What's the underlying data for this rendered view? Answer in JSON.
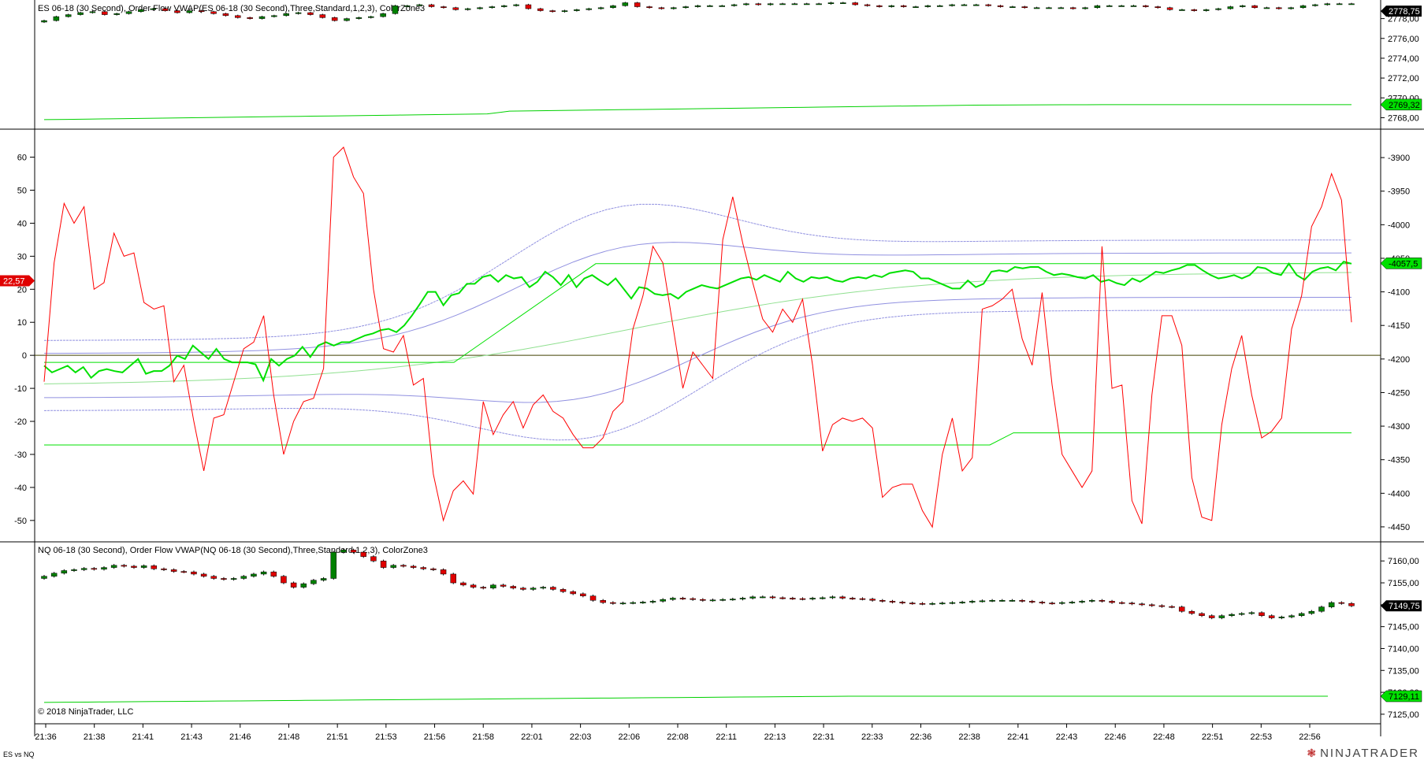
{
  "window": {
    "tab_label": "ES vs NQ",
    "brand": "NINJATRADER",
    "brand_icon": "ninja-logo-icon"
  },
  "colors": {
    "up": "#008000",
    "down": "#e00000",
    "vwap": "#00d000",
    "band": "#9090e0",
    "spread": "#ff0000",
    "diff": "#00e000",
    "zero": "#404000"
  },
  "chart_data": [
    {
      "type": "candlestick",
      "title": "ES 06-18 (30 Second), Order Flow VWAP(ES 06-18 (30 Second),Three,Standard,1,2,3), ColorZone3",
      "ylim": [
        2767,
        2779.4
      ],
      "y_ticks": [
        "2778,00",
        "2776,00",
        "2774,00",
        "2772,00",
        "2770,00",
        "2768,00"
      ],
      "y_tick_values": [
        2778,
        2776,
        2774,
        2772,
        2770,
        2768
      ],
      "last_price_label": "2778,75",
      "last_price": 2778.75,
      "vwap_label": "2769,32",
      "vwap_value": 2769.32,
      "closes": [
        2777.8,
        2778.2,
        2778.4,
        2778.6,
        2778.7,
        2778.4,
        2778.5,
        2778.7,
        2778.9,
        2779.0,
        2778.8,
        2778.6,
        2778.8,
        2778.7,
        2778.5,
        2778.3,
        2778.1,
        2778.0,
        2778.2,
        2778.3,
        2778.5,
        2778.6,
        2778.4,
        2778.1,
        2777.8,
        2778.0,
        2778.1,
        2778.2,
        2778.5,
        2779.3,
        2779.3,
        2779.4,
        2779.2,
        2779.1,
        2778.9,
        2779.0,
        2779.1,
        2779.2,
        2779.3,
        2779.4,
        2779.0,
        2778.8,
        2778.7,
        2778.8,
        2778.9,
        2779.0,
        2779.1,
        2779.3,
        2779.6,
        2779.2,
        2779.1,
        2779.0,
        2779.1,
        2779.2,
        2779.3,
        2779.3,
        2779.3,
        2779.4,
        2779.5,
        2779.4,
        2779.5,
        2779.5,
        2779.5,
        2779.5,
        2779.5,
        2779.6,
        2779.6,
        2779.4,
        2779.3,
        2779.2,
        2779.3,
        2779.2,
        2779.2,
        2779.3,
        2779.3,
        2779.4,
        2779.4,
        2779.4,
        2779.3,
        2779.2,
        2779.2,
        2779.1,
        2779.1,
        2779.1,
        2779.1,
        2779.0,
        2779.1,
        2779.3,
        2779.3,
        2779.3,
        2779.3,
        2779.2,
        2779.1,
        2778.9,
        2778.9,
        2778.8,
        2778.9,
        2779.0,
        2779.2,
        2779.3,
        2779.1,
        2779.1,
        2779.0,
        2779.1,
        2779.3,
        2779.4,
        2779.5,
        2779.5,
        2779.5
      ]
    },
    {
      "type": "line",
      "title": "",
      "left_ylim": [
        -56,
        68
      ],
      "left_ticks": [
        "60",
        "50",
        "40",
        "30",
        "20",
        "10",
        "0",
        "-10",
        "-20",
        "-30",
        "-40",
        "-50"
      ],
      "left_tick_values": [
        60,
        50,
        40,
        30,
        20,
        10,
        0,
        -10,
        -20,
        -30,
        -40,
        -50
      ],
      "right_ylim": [
        -4470,
        -3860
      ],
      "right_ticks": [
        "-3900",
        "-3950",
        "-4000",
        "-4050",
        "-4100",
        "-4150",
        "-4200",
        "-4250",
        "-4300",
        "-4350",
        "-4400",
        "-4450"
      ],
      "right_tick_values": [
        -3900,
        -3950,
        -4000,
        -4050,
        -4100,
        -4150,
        -4200,
        -4250,
        -4300,
        -4350,
        -4400,
        -4450
      ],
      "left_last_label": "22,57",
      "left_last_value": 22.57,
      "right_last_label": "-4057,5",
      "right_last_value": -4057.5,
      "series": [
        {
          "values": [
            -8,
            28,
            46,
            40,
            45,
            20,
            22,
            37,
            30,
            31,
            16,
            14,
            15,
            -8,
            -3,
            -20,
            -35,
            -19,
            -18,
            -8,
            2,
            4,
            12,
            -12,
            -30,
            -20,
            -14,
            -13,
            -4,
            60,
            63,
            54,
            49,
            20,
            2,
            1,
            6,
            -9,
            -7,
            -36,
            -50,
            -41,
            -38,
            -42,
            -14,
            -24,
            -18,
            -14,
            -22,
            -15,
            -12,
            -17,
            -19,
            -24,
            -28,
            -28,
            -25,
            -17,
            -14,
            8,
            18,
            33,
            28,
            9,
            -10,
            1,
            -3,
            -7,
            35,
            48,
            34,
            22,
            11,
            7,
            14,
            10,
            17,
            -3,
            -29,
            -21,
            -19,
            -20,
            -19,
            -22,
            -43,
            -40,
            -39,
            -39,
            -47,
            -52,
            -30,
            -19,
            -35,
            -31,
            14,
            15,
            17,
            20,
            5,
            -3,
            19,
            -9,
            -30,
            -35,
            -40,
            -35,
            33,
            -10,
            -9,
            -44,
            -51,
            -12,
            12,
            12,
            3,
            -37,
            -49,
            -50,
            -21,
            -4,
            6,
            -12,
            -25,
            -23,
            -19,
            8,
            18,
            39,
            45,
            55,
            47,
            10
          ],
          "color": "#ff0000"
        },
        {
          "values": [
            -4210,
            -4220,
            -4215,
            -4210,
            -4220,
            -4212,
            -4228,
            -4218,
            -4215,
            -4218,
            -4220,
            -4210,
            -4200,
            -4222,
            -4218,
            -4218,
            -4210,
            -4195,
            -4200,
            -4180,
            -4190,
            -4200,
            -4185,
            -4200,
            -4205,
            -4205,
            -4205,
            -4208,
            -4232,
            -4200,
            -4210,
            -4200,
            -4195,
            -4182,
            -4197,
            -4180,
            -4175,
            -4180,
            -4175,
            -4175,
            -4170,
            -4165,
            -4162,
            -4157,
            -4155,
            -4160,
            -4150,
            -4135,
            -4118,
            -4100,
            -4100,
            -4120,
            -4105,
            -4102,
            -4088,
            -4088,
            -4078,
            -4075,
            -4085,
            -4075,
            -4080,
            -4078,
            -4093,
            -4085,
            -4070,
            -4078,
            -4090,
            -4075,
            -4093,
            -4080,
            -4075,
            -4083,
            -4090,
            -4080,
            -4095,
            -4110,
            -4093,
            -4095,
            -4103,
            -4105,
            -4103,
            -4110,
            -4100,
            -4095,
            -4090,
            -4093,
            -4095,
            -4090,
            -4085,
            -4080,
            -4078,
            -4082,
            -4075,
            -4080,
            -4085,
            -4070,
            -4080,
            -4085,
            -4078,
            -4080,
            -4078,
            -4083,
            -4085,
            -4080,
            -4078,
            -4080,
            -4075,
            -4078,
            -4072,
            -4070,
            -4068,
            -4070,
            -4080,
            -4080,
            -4085,
            -4090,
            -4095,
            -4095,
            -4083,
            -4093,
            -4088,
            -4070,
            -4068,
            -4070,
            -4063,
            -4065,
            -4063,
            -4063,
            -4070,
            -4075,
            -4073,
            -4075,
            -4078,
            -4080,
            -4075,
            -4085,
            -4082,
            -4087,
            -4090,
            -4080,
            -4085,
            -4078,
            -4070,
            -4072,
            -4068,
            -4065,
            -4060,
            -4060,
            -4068,
            -4075,
            -4080,
            -4078,
            -4075,
            -4080,
            -4075,
            -4063,
            -4065,
            -4072,
            -4075,
            -4058,
            -4075,
            -4082,
            -4070,
            -4065,
            -4063,
            -4068,
            -4055,
            -4058
          ],
          "color": "#00e000"
        }
      ]
    },
    {
      "type": "candlestick",
      "title": "NQ 06-18 (30 Second), Order Flow VWAP(NQ 06-18 (30 Second),Three,Standard,1,2,3), ColorZone3",
      "ylim": [
        7123,
        7164
      ],
      "y_ticks": [
        "7160,00",
        "7155,00",
        "7150,00",
        "7145,00",
        "7140,00",
        "7135,00",
        "7130,00",
        "7125,00"
      ],
      "y_tick_values": [
        7160,
        7155,
        7150,
        7145,
        7140,
        7135,
        7130,
        7125
      ],
      "last_price_label": "7149,75",
      "last_price": 7149.75,
      "vwap_label": "7129,11",
      "vwap_value": 7129.11,
      "watermark": "© 2018 NinjaTrader, LLC",
      "closes": [
        7156.5,
        7157.2,
        7157.8,
        7158.0,
        7158.3,
        7158.1,
        7158.5,
        7159.0,
        7158.8,
        7158.5,
        7158.9,
        7158.2,
        7158.0,
        7157.6,
        7157.5,
        7157.0,
        7156.5,
        7156.0,
        7155.8,
        7156.0,
        7156.5,
        7157.0,
        7157.5,
        7156.5,
        7155.0,
        7154.0,
        7154.8,
        7155.6,
        7156.0,
        7162.0,
        7162.5,
        7162.0,
        7161.0,
        7160.0,
        7158.5,
        7159.0,
        7158.8,
        7158.5,
        7158.2,
        7158.0,
        7157.0,
        7155.0,
        7154.5,
        7154.0,
        7153.8,
        7154.5,
        7154.2,
        7153.8,
        7153.5,
        7153.8,
        7154.0,
        7153.5,
        7153.0,
        7152.5,
        7152.0,
        7151.0,
        7150.5,
        7150.3,
        7150.4,
        7150.5,
        7150.6,
        7150.8,
        7151.2,
        7151.5,
        7151.4,
        7151.2,
        7151.0,
        7151.1,
        7151.2,
        7151.3,
        7151.5,
        7151.8,
        7151.8,
        7151.6,
        7151.5,
        7151.4,
        7151.3,
        7151.5,
        7151.6,
        7151.8,
        7151.5,
        7151.4,
        7151.3,
        7151.0,
        7150.8,
        7150.6,
        7150.4,
        7150.3,
        7150.2,
        7150.3,
        7150.4,
        7150.5,
        7150.6,
        7150.8,
        7150.9,
        7151.0,
        7151.0,
        7151.0,
        7150.8,
        7150.6,
        7150.4,
        7150.3,
        7150.5,
        7150.6,
        7150.8,
        7151.0,
        7150.8,
        7150.5,
        7150.4,
        7150.2,
        7150.0,
        7149.8,
        7149.6,
        7149.5,
        7148.5,
        7148.0,
        7147.5,
        7147.0,
        7147.5,
        7147.8,
        7148.0,
        7148.2,
        7147.5,
        7147.0,
        7147.2,
        7147.5,
        7148.0,
        7148.5,
        7149.5,
        7150.5,
        7150.3,
        7149.75
      ]
    }
  ],
  "x_axis": {
    "labels": [
      "21:36",
      "21:38",
      "21:41",
      "21:43",
      "21:46",
      "21:48",
      "21:51",
      "21:53",
      "21:56",
      "21:58",
      "22:01",
      "22:03",
      "22:06",
      "22:08",
      "22:11",
      "22:13",
      "22:31",
      "22:33",
      "22:36",
      "22:38",
      "22:41",
      "22:43",
      "22:46",
      "22:48",
      "22:51",
      "22:53",
      "22:56"
    ]
  }
}
